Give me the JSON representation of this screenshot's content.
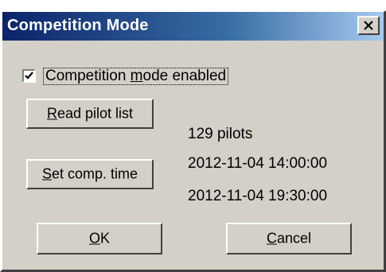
{
  "window": {
    "title": "Competition Mode"
  },
  "checkbox": {
    "checked": true,
    "label_pre": "Competition ",
    "label_accel": "m",
    "label_post": "ode enabled"
  },
  "buttons": {
    "read_pilot_list": {
      "accel": "R",
      "rest": "ead pilot list"
    },
    "set_comp_time": {
      "accel": "S",
      "rest": "et comp. time"
    },
    "ok": {
      "accel": "O",
      "rest": "K"
    },
    "cancel": {
      "accel": "C",
      "rest": "ancel"
    }
  },
  "info": {
    "pilot_count": "129 pilots",
    "start_time": "2012-11-04  14:00:00",
    "end_time": "2012-11-04  19:30:00"
  },
  "icons": {
    "close": "close-icon",
    "check": "checkmark-icon"
  },
  "colors": {
    "face": "#d4d0c8",
    "title_start": "#0a246a",
    "title_end": "#a6caf0"
  }
}
